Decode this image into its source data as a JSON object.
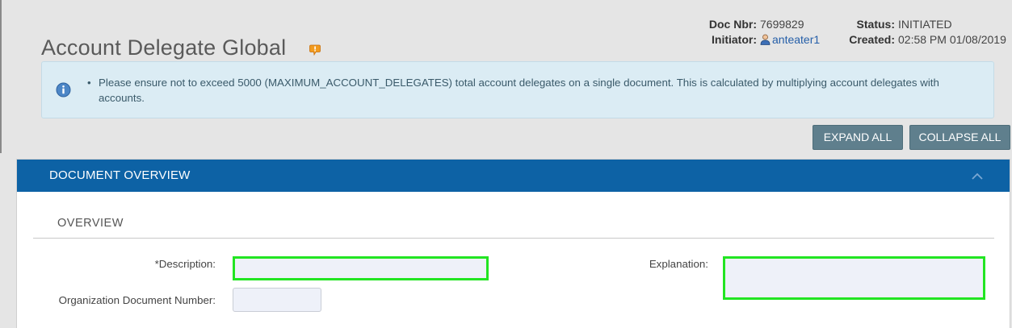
{
  "page": {
    "title": "Account Delegate Global",
    "help_icon": "help-bubble-icon"
  },
  "doc_info": {
    "doc_nbr_label": "Doc Nbr:",
    "doc_nbr": "7699829",
    "initiator_label": "Initiator:",
    "initiator": "anteater1",
    "status_label": "Status:",
    "status": "INITIATED",
    "created_label": "Created:",
    "created": "02:58 PM 01/08/2019"
  },
  "info_message": {
    "icon": "info-icon",
    "text": "Please ensure not to exceed 5000 (MAXIMUM_ACCOUNT_DELEGATES) total account delegates on a single document. This is calculated by multiplying account delegates with accounts."
  },
  "toolbar": {
    "expand_all": "EXPAND ALL",
    "collapse_all": "COLLAPSE ALL"
  },
  "document_overview": {
    "header": "DOCUMENT OVERVIEW",
    "section_title": "OVERVIEW",
    "fields": {
      "description_label": "*Description:",
      "description_value": "",
      "org_doc_number_label": "Organization Document Number:",
      "org_doc_number_value": "",
      "explanation_label": "Explanation:",
      "explanation_value": ""
    }
  },
  "colors": {
    "panel_header": "#0d62a5",
    "button": "#5f7f8d",
    "info_background": "#dbecf4",
    "focus_outline": "#22e522"
  }
}
